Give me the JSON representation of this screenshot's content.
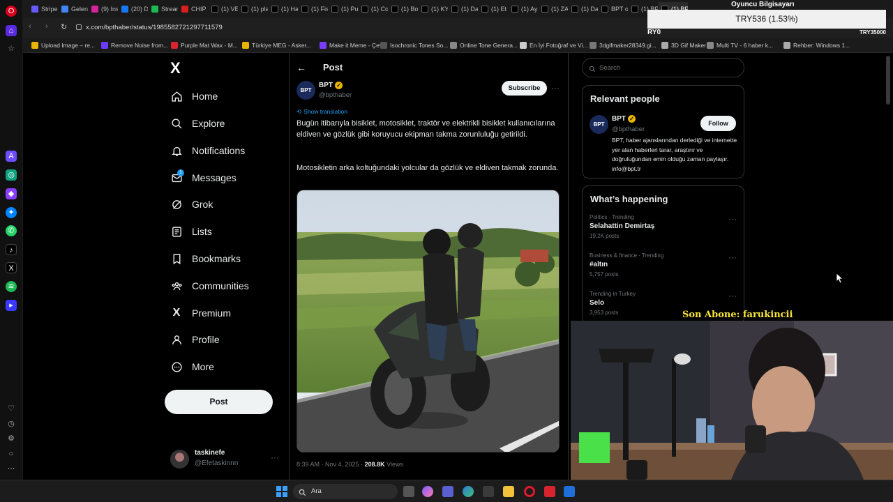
{
  "browser": {
    "tabs": [
      "Stripe",
      "Gelen",
      "(9) Ins",
      "(20) D",
      "Stream",
      "CHIP C",
      "(1) VE",
      "(1) pla",
      "(1) Ha",
      "(1) Fis",
      "(1) Pu",
      "(1) Co",
      "(1) Bo",
      "(1) KY",
      "(1) Da",
      "(1) Et",
      "(1) Ay",
      "(1) ZA",
      "(1) Da",
      "BPT or",
      "(1) BP",
      "(1) BPT on"
    ],
    "url": "x.com/bpthaber/status/1985582721297711579",
    "bookmarks": [
      "Upload Image – re...",
      "Remove Noise from...",
      "Purple Mat Wax - M...",
      "Türkiye MEG - Asker...",
      "Make it Meme - Çev...",
      "Isochronic Tones So...",
      "Online Tone Genera...",
      "En İyi Fotoğraf ve Vi...",
      "3dgifmaker28349.gi...",
      "3D Gif Maker",
      "Multi TV - 6 haber k...",
      "Rehber: Windows 1..."
    ]
  },
  "nav": {
    "logo": "X",
    "items": [
      "Home",
      "Explore",
      "Notifications",
      "Messages",
      "Grok",
      "Lists",
      "Bookmarks",
      "Communities",
      "Premium",
      "Profile",
      "More"
    ],
    "messages_badge": "1",
    "post_button": "Post",
    "account": {
      "name": "taskinefe",
      "handle": "@Efetaskinnn",
      "more": "···"
    }
  },
  "post": {
    "header": "Post",
    "back": "←",
    "author": {
      "avatar": "BPT",
      "name": "BPT",
      "handle": "@bpthaber"
    },
    "subscribe": "Subscribe",
    "more": "···",
    "show_translation": "Show translation",
    "paragraph1": "Bugün itibarıyla bisiklet, motosiklet, traktör ve elektrikli bisiklet kullanıcılarına eldiven ve gözlük gibi koruyucu ekipman takma zorunluluğu getirildi.",
    "paragraph2": "Motosikletin arka koltuğundaki yolcular da gözlük ve eldiven takmak zorunda.",
    "time": "8:39 AM · Nov 4, 2025 ·",
    "views_count": "208.8K",
    "views_label": "Views"
  },
  "right": {
    "search_placeholder": "Search",
    "relevant": {
      "title": "Relevant people",
      "avatar": "BPT",
      "name": "BPT",
      "handle": "@bpthaber",
      "follow": "Follow",
      "bio": "BPT, haber ajanslarından derlediği ve internette yer alan haberleri tarar, araştırır ve doğruluğundan emin olduğu zaman paylaşır. info@bpt.tr"
    },
    "happening": {
      "title": "What’s happening",
      "trends": [
        {
          "meta": "Politics · Trending",
          "title": "Selahattin Demirtaş",
          "count": "19.2K posts"
        },
        {
          "meta": "Business & finance · Trending",
          "title": "#altın",
          "count": "5,757 posts"
        },
        {
          "meta": "Trending in Turkey",
          "title": "Selo",
          "count": "3,953 posts"
        }
      ]
    }
  },
  "overlay": {
    "stream_title": "Oyuncu Bilgisayarı",
    "ticker": "TRY536 (1.53%)",
    "ticker_left": "RY0",
    "ticker_right": "TRY35000",
    "sub_banner": "Son Abone: farukincii"
  },
  "taskbar": {
    "search": "Ara"
  },
  "colors": {
    "bg": "#000000",
    "text": "#e7e9ea",
    "muted": "#71767b",
    "border": "#2f3336",
    "link": "#1d9bf0",
    "verified": "#e8b400",
    "banner": "#f7e53b"
  }
}
